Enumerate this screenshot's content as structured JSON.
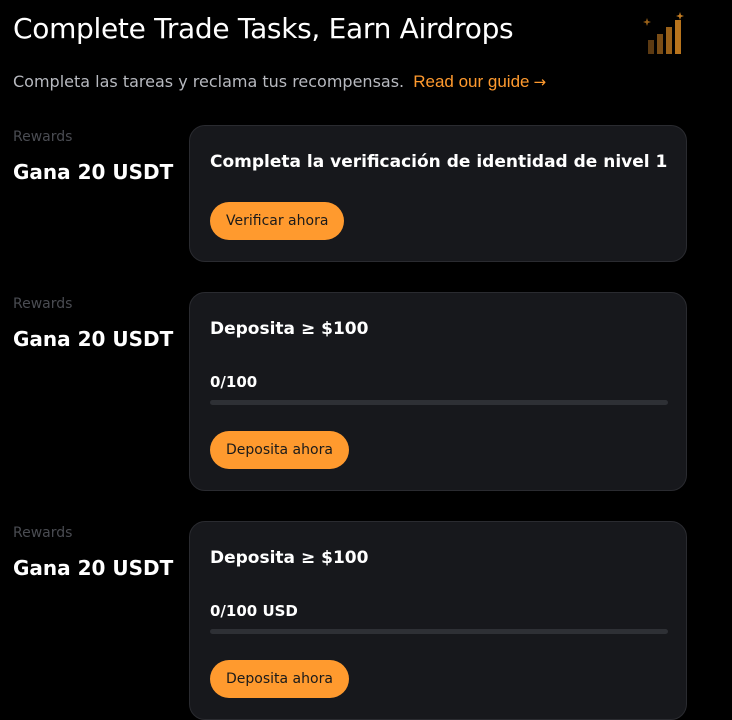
{
  "header": {
    "title": "Complete Trade Tasks, Earn Airdrops",
    "subtitle": "Completa las tareas y reclama tus recompensas.",
    "guide_link": "Read our guide",
    "guide_arrow": "→",
    "icon": "bar-chart-growth-icon"
  },
  "colors": {
    "accent": "#ff9a2e",
    "card_bg": "#17181c",
    "page_bg": "#000000"
  },
  "tasks": [
    {
      "reward_label": "Rewards",
      "reward_amount": "Gana 20 USDT",
      "title": "Completa la verificación de identidad de nivel 1",
      "button": "Verificar ahora"
    },
    {
      "reward_label": "Rewards",
      "reward_amount": "Gana 20 USDT",
      "title": "Deposita ≥ $100",
      "progress_text": "0/100",
      "progress_fraction": 0,
      "button": "Deposita ahora"
    },
    {
      "reward_label": "Rewards",
      "reward_amount": "Gana 20 USDT",
      "title": "Deposita ≥ $100",
      "progress_text": "0/100 USD",
      "progress_fraction": 0,
      "button": "Deposita ahora"
    }
  ]
}
